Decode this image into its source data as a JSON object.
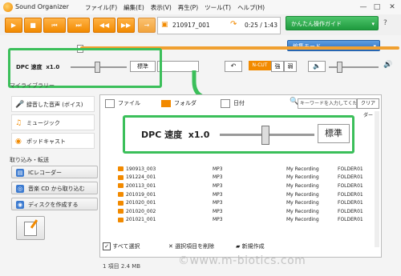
{
  "window": {
    "title": "Sound Organizer",
    "menu": [
      "ファイル(F)",
      "編集(E)",
      "表示(V)",
      "再生(P)",
      "ツール(T)",
      "ヘルプ(H)"
    ],
    "controls": {
      "minimize": "—",
      "maximize": "□",
      "close": "✕"
    }
  },
  "toolbar": {
    "file_name": "210917_001",
    "time": "0:25 / 1:43",
    "guide_label": "かんたん操作ガイド",
    "edit_mode_label": "編集モード"
  },
  "controls": {
    "dpc_label": "DPC 速度",
    "dpc_value": "x1.0",
    "standard_label": "標準",
    "ncut_label": "N-CUT",
    "strong_label": "強",
    "weak_label": "弱"
  },
  "sidebar": {
    "library_title": "マイライブラリー",
    "items": [
      {
        "label": "録音した音声 (ボイス)",
        "icon": "microphone-icon"
      },
      {
        "label": "ミュージック",
        "icon": "music-note-icon"
      },
      {
        "label": "ポッドキャスト",
        "icon": "podcast-icon"
      }
    ],
    "transfer_title": "取り込み・転送",
    "buttons": [
      {
        "label": "ICレコーダー",
        "icon": "ic-recorder-icon"
      },
      {
        "label": "音楽 CD から取り込む",
        "icon": "cd-icon"
      },
      {
        "label": "ディスクを作成する",
        "icon": "disc-icon"
      }
    ]
  },
  "main": {
    "tabs": [
      "ファイル",
      "フォルダ",
      "日付"
    ],
    "search_placeholder": "キーワードを入力してください",
    "clear_label": "クリア",
    "folder_header": "ダー",
    "rows": [
      {
        "name": "190913_003",
        "format": "MP3",
        "artist": "My Recording",
        "folder": "FOLDER01"
      },
      {
        "name": "191224_001",
        "format": "MP3",
        "artist": "My Recording",
        "folder": "FOLDER01"
      },
      {
        "name": "200113_001",
        "format": "MP3",
        "artist": "My Recording",
        "folder": "FOLDER01"
      },
      {
        "name": "201019_001",
        "format": "MP3",
        "artist": "My Recording",
        "folder": "FOLDER01"
      },
      {
        "name": "201020_001",
        "format": "MP3",
        "artist": "My Recording",
        "folder": "FOLDER01"
      },
      {
        "name": "201020_002",
        "format": "MP3",
        "artist": "My Recording",
        "folder": "FOLDER01"
      },
      {
        "name": "201021_001",
        "format": "MP3",
        "artist": "My Recording",
        "folder": "FOLDER01"
      }
    ],
    "select_all_label": "すべて選択",
    "delete_label": "選択項目を削除",
    "new_label": "新規作成"
  },
  "status": "1 項目 2.4 MB",
  "watermark": "©www.m-biotics.com",
  "colors": {
    "accent": "#f28a00",
    "green": "#3bbf5a",
    "blue": "#2b6fc1"
  }
}
